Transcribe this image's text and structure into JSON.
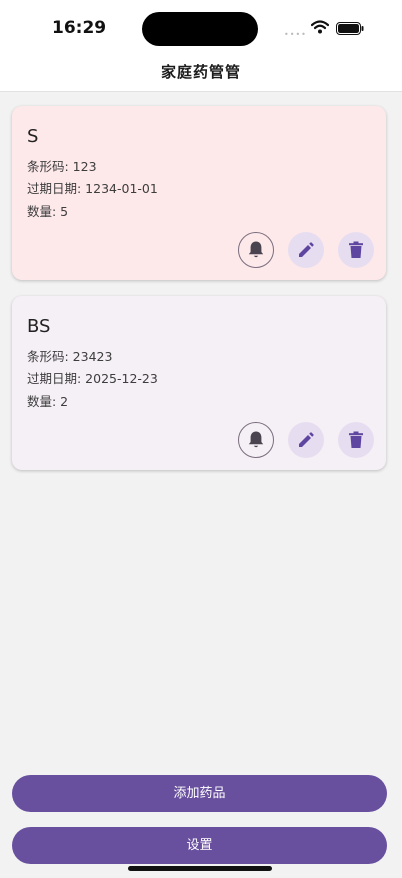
{
  "status_bar": {
    "time": "16:29",
    "signal_dots": "••••"
  },
  "app_bar": {
    "title": "家庭药管管"
  },
  "medicines": [
    {
      "name": "S",
      "barcode": "条形码: 123",
      "expiry": "过期日期: 1234-01-01",
      "quantity": "数量: 5",
      "expired": true
    },
    {
      "name": "BS",
      "barcode": "条形码: 23423",
      "expiry": "过期日期: 2025-12-23",
      "quantity": "数量: 2",
      "expired": false
    }
  ],
  "actions": {
    "reminder_icon": "bell-icon",
    "edit_icon": "pencil-icon",
    "delete_icon": "trash-icon"
  },
  "buttons": {
    "add_label": "添加药品",
    "settings_label": "设置"
  },
  "colors": {
    "primary": "#68509f",
    "expired_card_bg": "#fde8ea",
    "normal_card_bg": "#f5eff6",
    "icon_purple": "#5e45a0",
    "bell_dark": "#4a4350"
  }
}
